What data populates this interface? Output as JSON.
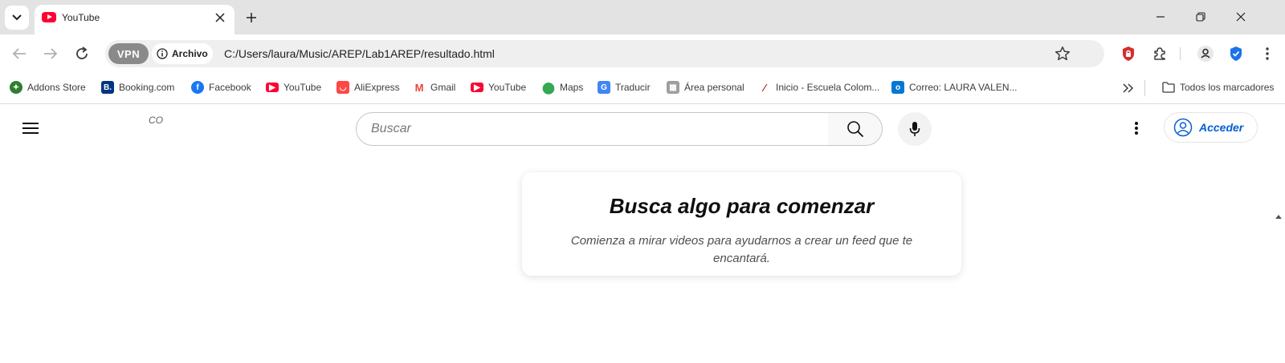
{
  "browser": {
    "tab": {
      "title": "YouTube"
    },
    "omnibox": {
      "vpn_label": "VPN",
      "origin_label": "Archivo",
      "url": "C:/Users/laura/Music/AREP/Lab1AREP/resultado.html"
    },
    "bookmarks": [
      {
        "label": "Addons Store",
        "icon": "addons-store-icon",
        "color": "#2e7d32"
      },
      {
        "label": "Booking.com",
        "icon": "booking-icon",
        "color": "#003580"
      },
      {
        "label": "Facebook",
        "icon": "facebook-icon",
        "color": "#1877f2"
      },
      {
        "label": "YouTube",
        "icon": "youtube-icon",
        "color": "#ff0033"
      },
      {
        "label": "AliExpress",
        "icon": "aliexpress-icon",
        "color": "#ff4747"
      },
      {
        "label": "Gmail",
        "icon": "gmail-icon",
        "color": "#ea4335"
      },
      {
        "label": "YouTube",
        "icon": "youtube-icon",
        "color": "#ff0033"
      },
      {
        "label": "Maps",
        "icon": "maps-icon",
        "color": "#34a853"
      },
      {
        "label": "Traducir",
        "icon": "translate-icon",
        "color": "#4285f4"
      },
      {
        "label": "Área personal",
        "icon": "personal-area-icon",
        "color": "#888888"
      },
      {
        "label": "Inicio - Escuela Colom...",
        "icon": "escuela-icon",
        "color": "#b22222"
      },
      {
        "label": "Correo: LAURA VALEN...",
        "icon": "outlook-icon",
        "color": "#0078d4"
      }
    ],
    "all_bookmarks_label": "Todos los marcadores"
  },
  "page": {
    "logo_text": "CO",
    "search": {
      "placeholder": "Buscar"
    },
    "signin_label": "Acceder",
    "empty_state": {
      "title": "Busca algo para comenzar",
      "subtitle": "Comienza a mirar videos para ayudarnos a crear un feed que te encantará."
    }
  },
  "colors": {
    "accent": "#065fd4",
    "youtube_red": "#ff0033",
    "vpn_chip": "#8a8a8a"
  }
}
